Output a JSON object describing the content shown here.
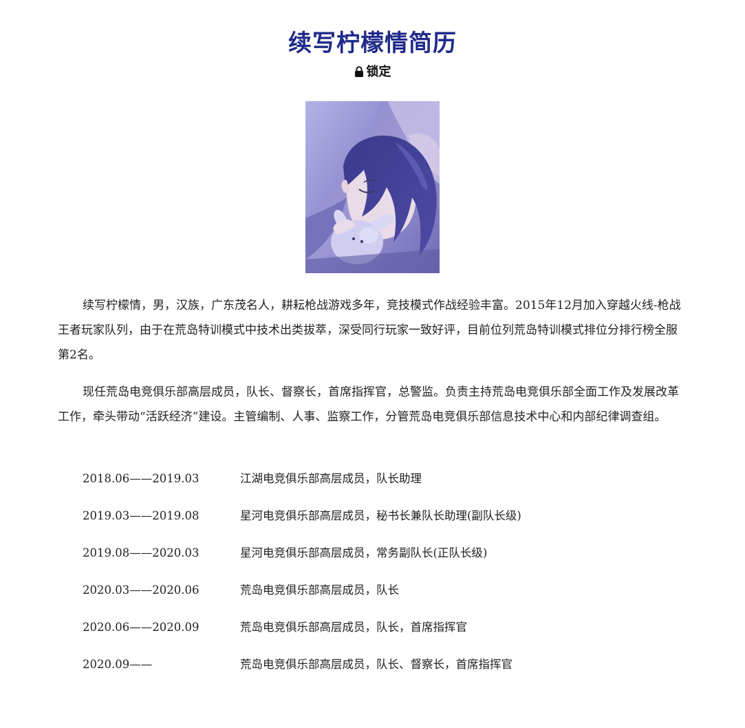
{
  "page": {
    "title": "续写柠檬情简历",
    "status_label": "锁定"
  },
  "portrait": {
    "icon": "anime-portrait-image"
  },
  "bio": {
    "paragraph1": "续写柠檬情，男，汉族，广东茂名人，耕耘枪战游戏多年，竞技模式作战经验丰富。2015年12月加入穿越火线-枪战王者玩家队列，由于在荒岛特训模式中技术出类拔萃，深受同行玩家一致好评，目前位列荒岛特训模式排位分排行榜全服第2名。",
    "paragraph2": "现任荒岛电竞俱乐部高层成员，队长、督察长，首席指挥官，总警监。负责主持荒岛电竞俱乐部全面工作及发展改革工作，牵头带动“活跃经济”建设。主管编制、人事、监察工作，分管荒岛电竞俱乐部信息技术中心和内部纪律调查组。"
  },
  "timeline": [
    {
      "date": "2018.06——2019.03",
      "role": "江湖电竞俱乐部高层成员，队长助理"
    },
    {
      "date": "2019.03——2019.08",
      "role": "星河电竞俱乐部高层成员，秘书长兼队长助理(副队长级)"
    },
    {
      "date": "2019.08——2020.03",
      "role": "星河电竞俱乐部高层成员，常务副队长(正队长级)"
    },
    {
      "date": "2020.03——2020.06",
      "role": "荒岛电竞俱乐部高层成员，队长"
    },
    {
      "date": "2020.06——2020.09",
      "role": "荒岛电竞俱乐部高层成员，队长，首席指挥官"
    },
    {
      "date": "2020.09——",
      "role": "荒岛电竞俱乐部高层成员，队长、督察长，首席指挥官"
    }
  ]
}
